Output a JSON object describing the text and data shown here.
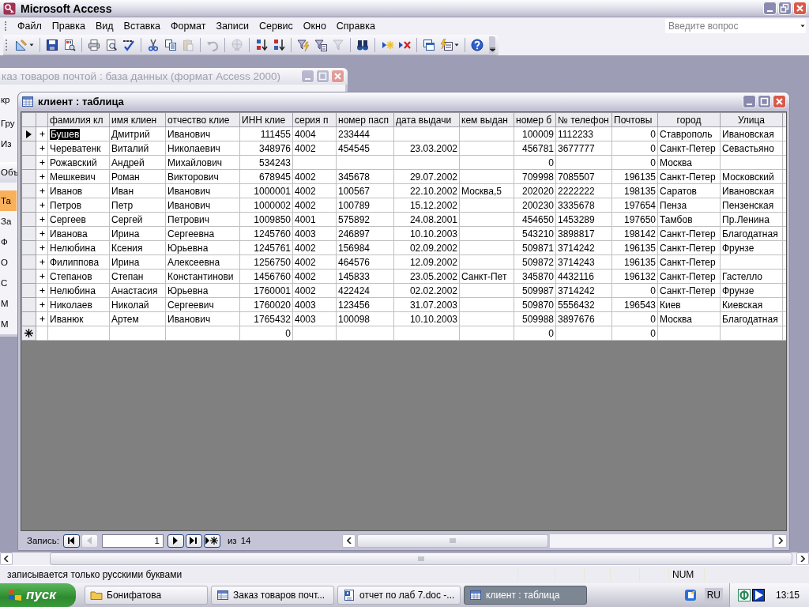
{
  "app_window": {
    "title": "Microsoft Access"
  },
  "menu": [
    {
      "label": "Файл"
    },
    {
      "label": "Правка"
    },
    {
      "label": "Вид"
    },
    {
      "label": "Вставка"
    },
    {
      "label": "Формат"
    },
    {
      "label": "Записи"
    },
    {
      "label": "Сервис"
    },
    {
      "label": "Окно"
    },
    {
      "label": "Справка"
    }
  ],
  "help_box": {
    "placeholder": "Введите вопрос"
  },
  "toolbar": [
    {
      "kind": "design",
      "disabled": false
    },
    {
      "kind": "separator"
    },
    {
      "kind": "save",
      "disabled": false
    },
    {
      "kind": "search",
      "disabled": false
    },
    {
      "kind": "separator"
    },
    {
      "kind": "print",
      "disabled": false
    },
    {
      "kind": "preview",
      "disabled": false
    },
    {
      "kind": "spell",
      "disabled": false
    },
    {
      "kind": "separator"
    },
    {
      "kind": "cut",
      "disabled": false
    },
    {
      "kind": "copy",
      "disabled": false
    },
    {
      "kind": "paste",
      "disabled": true
    },
    {
      "kind": "separator"
    },
    {
      "kind": "undo",
      "disabled": true
    },
    {
      "kind": "separator"
    },
    {
      "kind": "globe",
      "disabled": true
    },
    {
      "kind": "separator"
    },
    {
      "kind": "sort_asc",
      "disabled": false
    },
    {
      "kind": "sort_desc",
      "disabled": false
    },
    {
      "kind": "separator"
    },
    {
      "kind": "filter_selection",
      "disabled": false
    },
    {
      "kind": "filter_form",
      "disabled": false
    },
    {
      "kind": "filter",
      "disabled": true
    },
    {
      "kind": "separator"
    },
    {
      "kind": "find",
      "disabled": false
    },
    {
      "kind": "separator"
    },
    {
      "kind": "new_record",
      "disabled": false
    },
    {
      "kind": "delete_record",
      "disabled": false
    },
    {
      "kind": "separator"
    },
    {
      "kind": "db_window",
      "disabled": false
    },
    {
      "kind": "new_object",
      "disabled": false
    },
    {
      "kind": "separator"
    },
    {
      "kind": "help",
      "disabled": false
    }
  ],
  "database_window": {
    "title": "каз товаров почтой : база данных (формат Access 2000)",
    "active": false,
    "sidebar": [
      {
        "kind": "toolbar",
        "label": "кр",
        "selected": false
      },
      {
        "kind": "item",
        "label": "Гру",
        "selected": false
      },
      {
        "kind": "item",
        "label": "Из",
        "selected": false
      },
      {
        "kind": "header",
        "label": "Объ",
        "selected": false
      },
      {
        "kind": "item",
        "label": "Та",
        "selected": true
      },
      {
        "kind": "item",
        "label": "За",
        "selected": false
      },
      {
        "kind": "item",
        "label": "Ф",
        "selected": false
      },
      {
        "kind": "item",
        "label": "О",
        "selected": false
      },
      {
        "kind": "item",
        "label": "С",
        "selected": false
      },
      {
        "kind": "item",
        "label": "М",
        "selected": false
      },
      {
        "kind": "item",
        "label": "М",
        "selected": false
      }
    ]
  },
  "table_window": {
    "title": "клиент : таблица",
    "columns": [
      {
        "label": "фамилия  кл",
        "numeric": false,
        "centered": false
      },
      {
        "label": "имя  клиен",
        "numeric": false,
        "centered": false
      },
      {
        "label": "отчество  клие",
        "numeric": false,
        "centered": false
      },
      {
        "label": "ИНН  клие",
        "numeric": true,
        "centered": false
      },
      {
        "label": "серия   п",
        "numeric": false,
        "centered": false
      },
      {
        "label": "номер пасп",
        "numeric": false,
        "centered": false
      },
      {
        "label": "дата  выдачи",
        "numeric": true,
        "centered": false
      },
      {
        "label": "кем выдан",
        "numeric": false,
        "centered": false
      },
      {
        "label": "номер б",
        "numeric": true,
        "centered": false
      },
      {
        "label": "№ телефон",
        "numeric": false,
        "centered": false
      },
      {
        "label": "Почтовы",
        "numeric": true,
        "centered": false
      },
      {
        "label": "город",
        "numeric": false,
        "centered": true
      },
      {
        "label": "Улица",
        "numeric": false,
        "centered": true
      }
    ],
    "rows": [
      {
        "current": true,
        "cells": [
          "Бушев",
          "Дмитрий",
          "Иванович",
          "111455",
          "4004",
          "233444",
          null,
          null,
          "100009",
          "1112233",
          "0",
          "Ставрополь",
          "Ивановская"
        ]
      },
      {
        "current": false,
        "cells": [
          "Череватенк",
          "Виталий",
          "Николаевич",
          "348976",
          "4002",
          "454545",
          "23.03.2002",
          null,
          "456781",
          "3677777",
          "0",
          "Санкт-Петер",
          "Севастьяно"
        ]
      },
      {
        "current": false,
        "cells": [
          "Рожавский",
          "Андрей",
          "Михайлович",
          "534243",
          null,
          null,
          null,
          null,
          "0",
          null,
          "0",
          "Москва",
          null
        ]
      },
      {
        "current": false,
        "cells": [
          "Мешкевич",
          "Роман",
          "Викторович",
          "678945",
          "4002",
          "345678",
          "29.07.2002",
          null,
          "709998",
          "7085507",
          "196135",
          "Санкт-Петер",
          "Московский"
        ]
      },
      {
        "current": false,
        "cells": [
          "Иванов",
          "Иван",
          "Иванович",
          "1000001",
          "4002",
          "100567",
          "22.10.2002",
          "Москва,5",
          "202020",
          "2222222",
          "198135",
          "Саратов",
          "Ивановская"
        ]
      },
      {
        "current": false,
        "cells": [
          "Петров",
          "Петр",
          "Иванович",
          "1000002",
          "4002",
          "100789",
          "15.12.2002",
          null,
          "200230",
          "3335678",
          "197654",
          "Пенза",
          "Пензенская"
        ]
      },
      {
        "current": false,
        "cells": [
          "Сергеев",
          "Сергей",
          "Петрович",
          "1009850",
          "4001",
          "575892",
          "24.08.2001",
          null,
          "454650",
          "1453289",
          "197650",
          "Тамбов",
          "Пр.Ленина"
        ]
      },
      {
        "current": false,
        "cells": [
          "Иванова",
          "Ирина",
          "Сергеевна",
          "1245760",
          "4003",
          "246897",
          "10.10.2003",
          null,
          "543210",
          "3898817",
          "198142",
          "Санкт-Петер",
          "Благодатная"
        ]
      },
      {
        "current": false,
        "cells": [
          "Нелюбина",
          "Ксения",
          "Юрьевна",
          "1245761",
          "4002",
          "156984",
          "02.09.2002",
          null,
          "509871",
          "3714242",
          "196135",
          "Санкт-Петер",
          "Фрунзе"
        ]
      },
      {
        "current": false,
        "cells": [
          "Филиппова",
          "Ирина",
          "Алексеевна",
          "1256750",
          "4002",
          "464576",
          "12.09.2002",
          null,
          "509872",
          "3714243",
          "196135",
          "Санкт-Петер",
          null
        ]
      },
      {
        "current": false,
        "cells": [
          "Степанов",
          "Степан",
          "Константинови",
          "1456760",
          "4002",
          "145833",
          "23.05.2002",
          "Санкт-Пет",
          "345870",
          "4432116",
          "196132",
          "Санкт-Петер",
          "Гастелло"
        ]
      },
      {
        "current": false,
        "cells": [
          "Нелюбина",
          "Анастасия",
          "Юрьевна",
          "1760001",
          "4002",
          "422424",
          "02.02.2002",
          null,
          "509987",
          "3714242",
          "0",
          "Санкт-Петер",
          "Фрунзе"
        ]
      },
      {
        "current": false,
        "cells": [
          "Николаев",
          "Николай",
          "Сергеевич",
          "1760020",
          "4003",
          "123456",
          "31.07.2003",
          null,
          "509870",
          "5556432",
          "196543",
          "Киев",
          "Киевская"
        ]
      },
      {
        "current": false,
        "cells": [
          "Иванюк",
          "Артем",
          "Иванович",
          "1765432",
          "4003",
          "100098",
          "10.10.2003",
          null,
          "509988",
          "3897676",
          "0",
          "Москва",
          "Благодатная"
        ]
      }
    ],
    "new_row": {
      "cells": [
        null,
        null,
        null,
        "0",
        null,
        null,
        null,
        null,
        "0",
        null,
        "0",
        null,
        null
      ]
    },
    "navigator": {
      "label": "Запись:",
      "record": "1",
      "of_label": "из",
      "count": "14"
    }
  },
  "status_bar": {
    "message": "записывается только русскими буквами",
    "indicator": "NUM"
  },
  "taskbar": {
    "start": "пуск",
    "tasks": [
      {
        "kind": "folder",
        "label": "Бонифатова",
        "selected": false
      },
      {
        "kind": "database",
        "label": "Заказ товаров почт...",
        "selected": false
      },
      {
        "kind": "document",
        "label": "отчет по лаб 7.doc -...",
        "selected": false
      },
      {
        "kind": "table",
        "label": "клиент : таблица",
        "selected": true
      }
    ],
    "language": "RU",
    "clock": "13:15"
  }
}
